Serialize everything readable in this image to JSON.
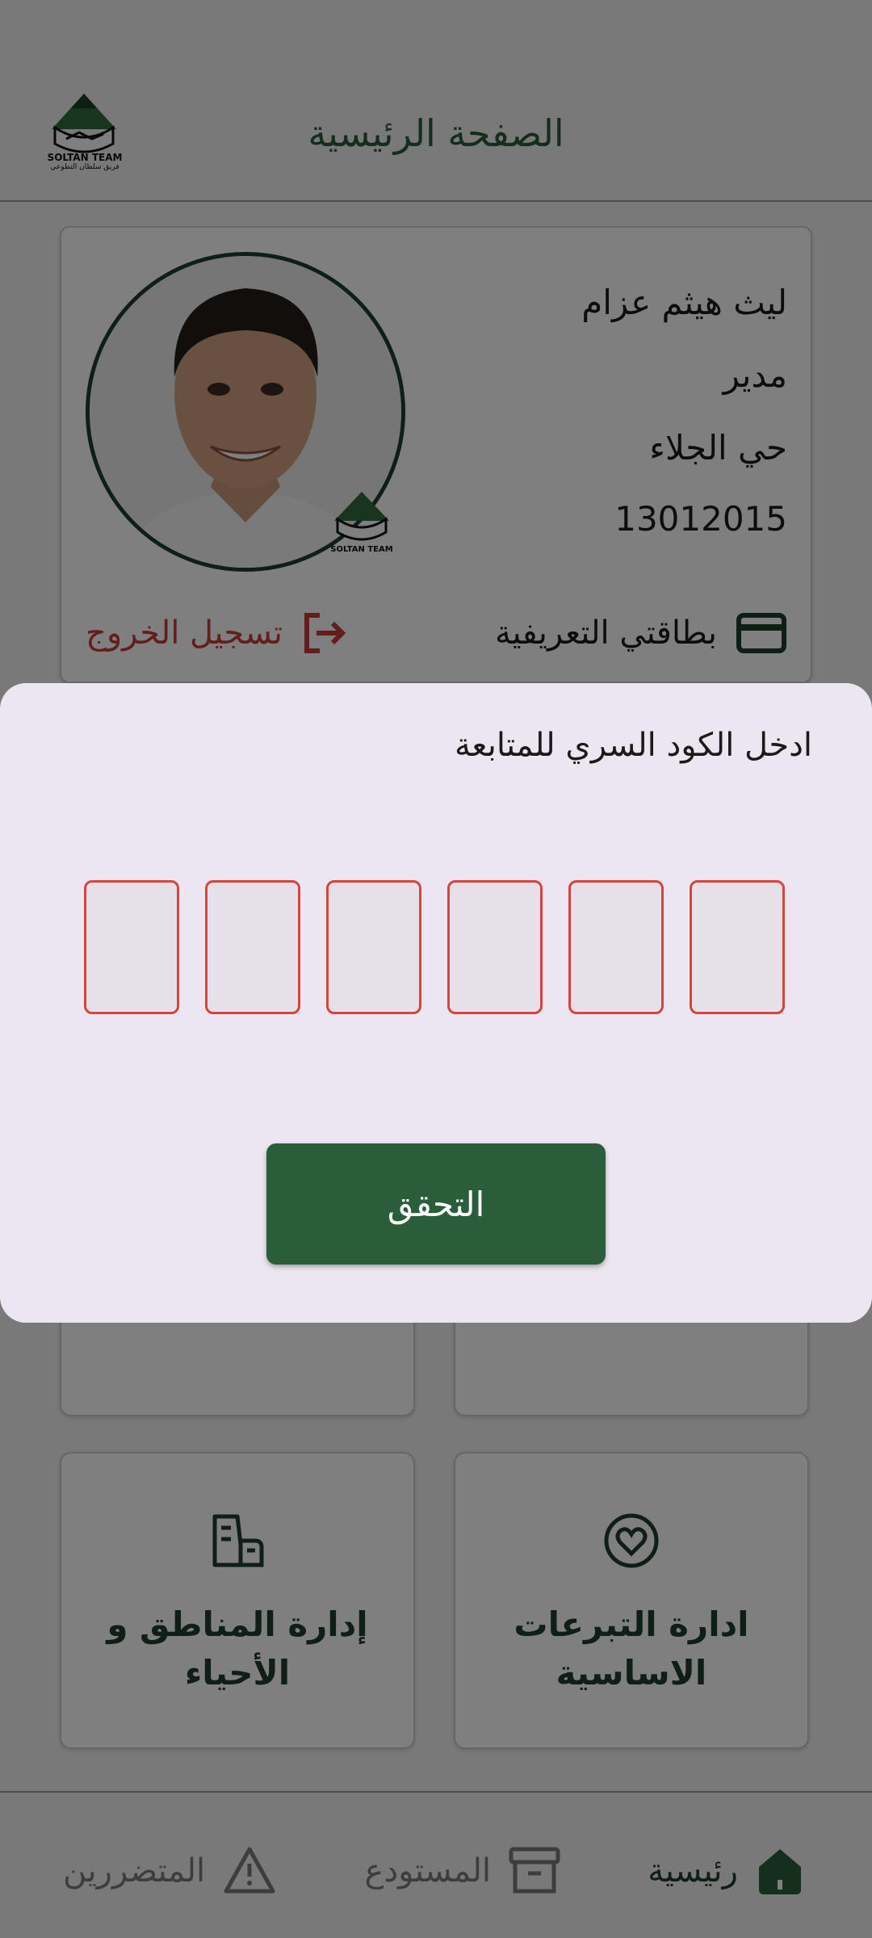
{
  "header": {
    "title": "الصفحة الرئيسية",
    "logo_text": "SOLTAN TEAM",
    "logo_subtext": "فريق سلطان التطوعي"
  },
  "profile": {
    "name": "ليث هيثم عزام",
    "role": "مدير",
    "district": "حي الجلاء",
    "number": "13012015",
    "id_card_label": "بطاقتي التعريفية",
    "logout_label": "تسجيل الخروج"
  },
  "tiles": [
    {
      "label_line1": "ادارة التبرعات",
      "label_line2": "الاساسية",
      "icon": "heart-icon"
    },
    {
      "label_line1": "إدارة المناطق و",
      "label_line2": "الأحياء",
      "icon": "buildings-icon"
    }
  ],
  "bottom_nav": [
    {
      "label": "رئيسية",
      "icon": "home-icon",
      "active": true
    },
    {
      "label": "المستودع",
      "icon": "archive-box-icon",
      "active": false
    },
    {
      "label": "المتضررين",
      "icon": "warning-icon",
      "active": false
    }
  ],
  "dialog": {
    "title": "ادخل الكود السري للمتابعة",
    "code_length": 6,
    "code_values": [
      "",
      "",
      "",
      "",
      "",
      ""
    ],
    "verify_label": "التحقق"
  },
  "colors": {
    "primary": "#2a5e3a",
    "danger": "#c63a3a",
    "sheet": "#ece6f0",
    "otp_border": "#d8433a"
  }
}
